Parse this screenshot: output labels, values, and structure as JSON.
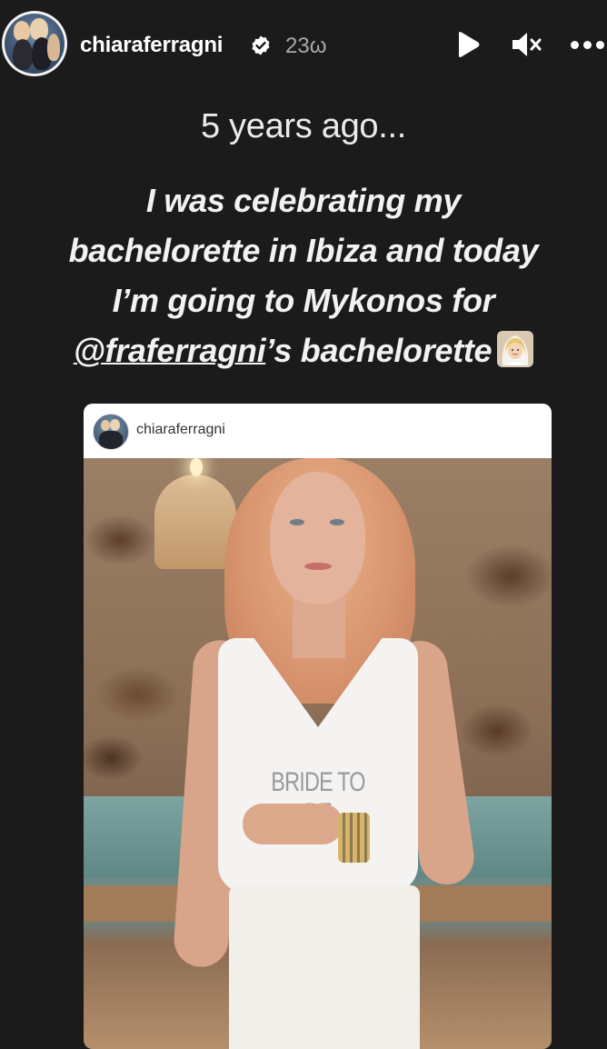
{
  "story": {
    "username": "chiaraferragni",
    "time": "23ω",
    "verified_icon": "verified-badge-icon",
    "controls": [
      "play-icon",
      "mute-icon",
      "more-icon"
    ]
  },
  "overlay": {
    "subtitle": "5 years ago...",
    "caption_lines": [
      "I was celebrating my",
      "bachelorette in Ibiza and today",
      "I’m going to Mykonos for"
    ],
    "mention": "@fraferragni",
    "caption_tail": "’s bachelorette",
    "emoji": "bride-with-veil-emoji"
  },
  "shared_post": {
    "username": "chiaraferragni",
    "shirt_text": "BRIDE TO BE"
  },
  "colors": {
    "background": "#1b1b1b",
    "text": "#f2f2f2",
    "muted": "#a9a9a9"
  }
}
